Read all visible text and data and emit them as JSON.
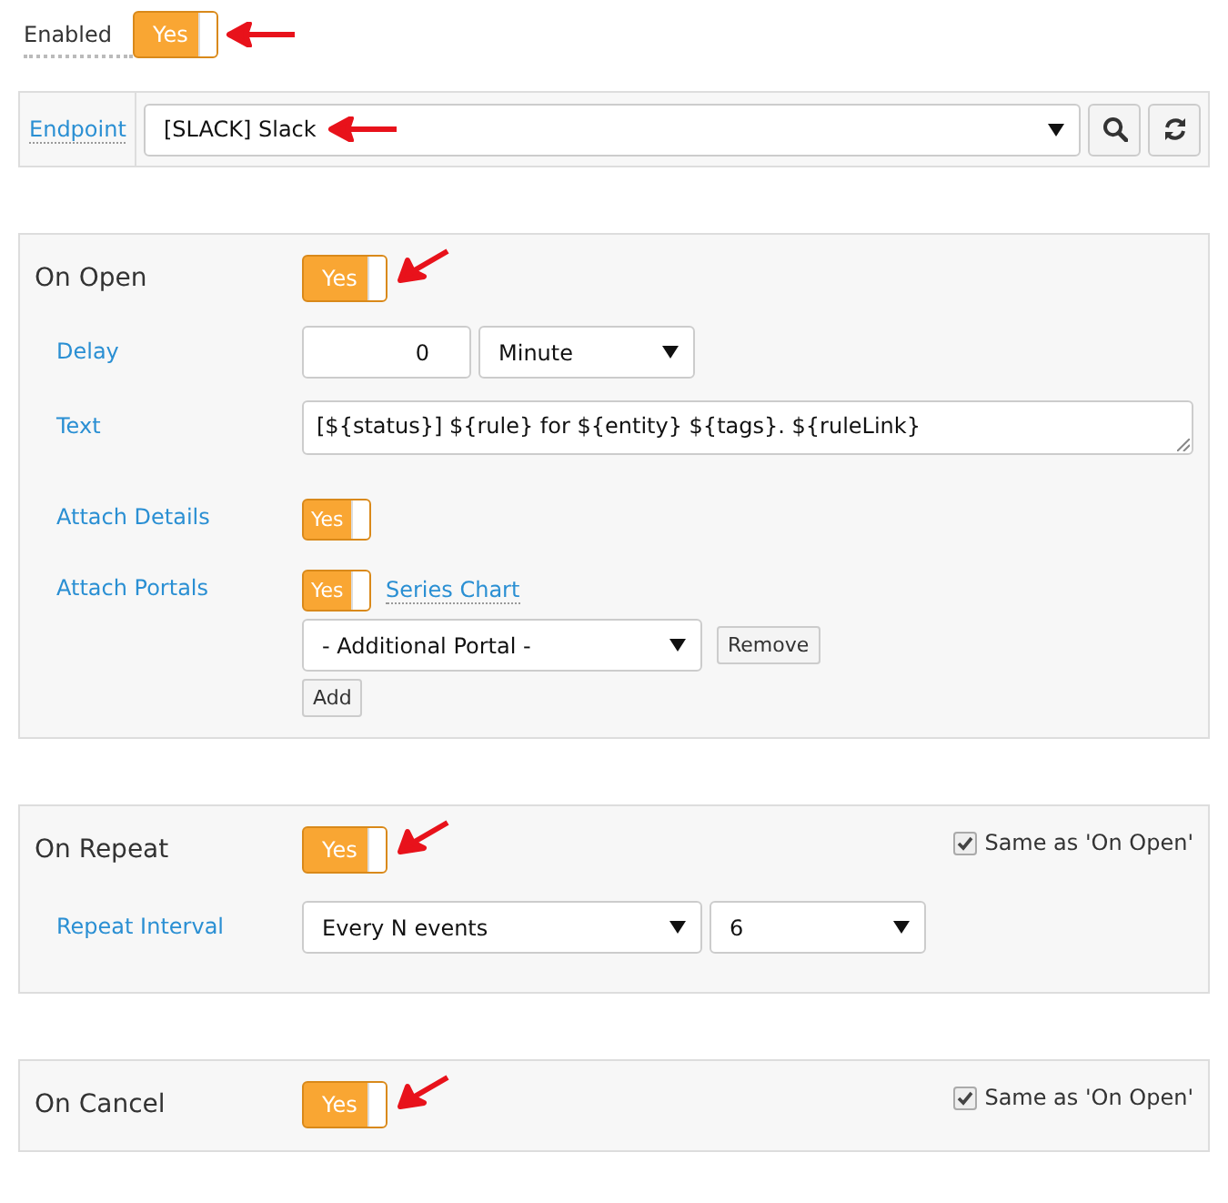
{
  "enabled": {
    "label": "Enabled",
    "toggle": {
      "on": true,
      "text": "Yes"
    }
  },
  "endpoint": {
    "label": "Endpoint",
    "value": "[SLACK] Slack"
  },
  "sections": [
    {
      "title": "On Open",
      "toggle": {
        "on": true,
        "text": "Yes"
      },
      "fields": [
        {
          "kind": "number_unit",
          "label": "Delay",
          "value": "0",
          "unit": "Minute"
        },
        {
          "kind": "textarea",
          "label": "Text",
          "value": "[${status}] ${rule} for ${entity} ${tags}. ${ruleLink}"
        },
        {
          "kind": "toggle",
          "label": "Attach Details",
          "toggle": {
            "on": true,
            "text": "Yes"
          }
        },
        {
          "kind": "portals",
          "label": "Attach Portals",
          "toggle": {
            "on": true,
            "text": "Yes"
          },
          "link": "Series Chart",
          "select": "- Additional Portal -",
          "remove": "Remove",
          "add": "Add"
        }
      ]
    },
    {
      "title": "On Repeat",
      "toggle": {
        "on": true,
        "text": "Yes"
      },
      "same_as": {
        "label": "Same as 'On Open'",
        "checked": true
      },
      "fields": [
        {
          "kind": "two_selects",
          "label": "Repeat Interval",
          "first": "Every N events",
          "second": "6"
        }
      ]
    },
    {
      "title": "On Cancel",
      "toggle": {
        "on": true,
        "text": "Yes"
      },
      "same_as": {
        "label": "Same as 'On Open'",
        "checked": true
      }
    }
  ]
}
